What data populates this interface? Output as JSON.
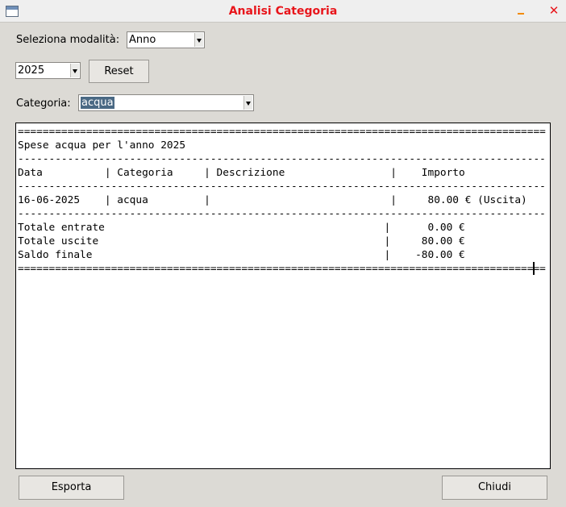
{
  "window": {
    "title": "Analisi Categoria",
    "minimize_glyph": "",
    "close_glyph": "✕"
  },
  "mode": {
    "label": "Seleziona modalità:",
    "value": "Anno"
  },
  "year": {
    "value": "2025",
    "reset_label": "Reset"
  },
  "category": {
    "label": "Categoria:",
    "value": "acqua"
  },
  "report": {
    "lines": [
      "=====================================================================================",
      "Spese acqua per l'anno 2025",
      "-------------------------------------------------------------------------------------",
      "Data          | Categoria     | Descrizione                 |    Importo",
      "-------------------------------------------------------------------------------------",
      "16-06-2025    | acqua         |                             |     80.00 € (Uscita)",
      "-------------------------------------------------------------------------------------",
      "Totale entrate                                             |      0.00 €",
      "Totale uscite                                              |     80.00 €",
      "Saldo finale                                               |    -80.00 €",
      "====================================================================================="
    ]
  },
  "buttons": {
    "export_label": "Esporta",
    "close_label": "Chiudi"
  },
  "colors": {
    "title": "#e8151b",
    "selection": "#4a6984",
    "background": "#dcdad5"
  }
}
